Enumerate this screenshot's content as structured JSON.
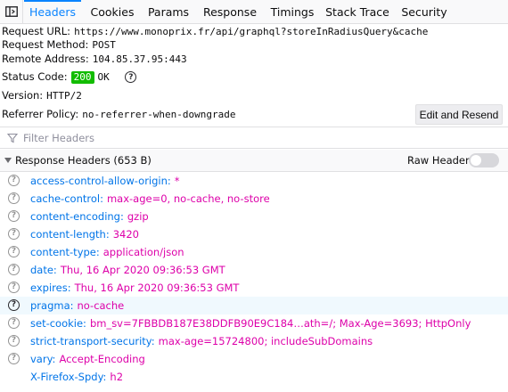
{
  "tabs": [
    "Headers",
    "Cookies",
    "Params",
    "Response",
    "Timings",
    "Stack Trace",
    "Security"
  ],
  "summary": {
    "request_url_label": "Request URL:",
    "request_url": "https://www.monoprix.fr/api/graphql?storeInRadiusQuery&cache",
    "request_method_label": "Request Method:",
    "request_method": "POST",
    "remote_address_label": "Remote Address:",
    "remote_address": "104.85.37.95:443",
    "status_code_label": "Status Code:",
    "status_code": "200",
    "status_text": "OK",
    "version_label": "Version:",
    "version": "HTTP/2",
    "referrer_policy_label": "Referrer Policy:",
    "referrer_policy": "no-referrer-when-downgrade",
    "edit_resend": "Edit and Resend"
  },
  "filter": {
    "placeholder": "Filter Headers"
  },
  "response_section": {
    "title": "Response Headers (653 B)",
    "raw_headers_label": "Raw Headers",
    "raw_headers_on": false
  },
  "headers": [
    {
      "name": "access-control-allow-origin:",
      "value": "*"
    },
    {
      "name": "cache-control:",
      "value": "max-age=0, no-cache, no-store"
    },
    {
      "name": "content-encoding:",
      "value": "gzip"
    },
    {
      "name": "content-length:",
      "value": "3420"
    },
    {
      "name": "content-type:",
      "value": "application/json"
    },
    {
      "name": "date:",
      "value": "Thu, 16 Apr 2020 09:36:53 GMT"
    },
    {
      "name": "expires:",
      "value": "Thu, 16 Apr 2020 09:36:53 GMT"
    },
    {
      "name": "pragma:",
      "value": "no-cache"
    },
    {
      "name": "set-cookie:",
      "value": "bm_sv=7FBBDB187E38DDFB90E9C184…ath=/; Max-Age=3693; HttpOnly"
    },
    {
      "name": "strict-transport-security:",
      "value": "max-age=15724800; includeSubDomains"
    },
    {
      "name": "vary:",
      "value": "Accept-Encoding"
    },
    {
      "name": "X-Firefox-Spdy:",
      "value": "h2"
    }
  ],
  "colors": {
    "accent": "#0a84ff",
    "status_ok": "#12bc00",
    "header_name": "#0074e8",
    "header_value": "#dd00a9"
  },
  "icons": {
    "panel_toggle": "sidebar-toggle-icon",
    "filter": "filter-icon",
    "help": "help-icon"
  }
}
